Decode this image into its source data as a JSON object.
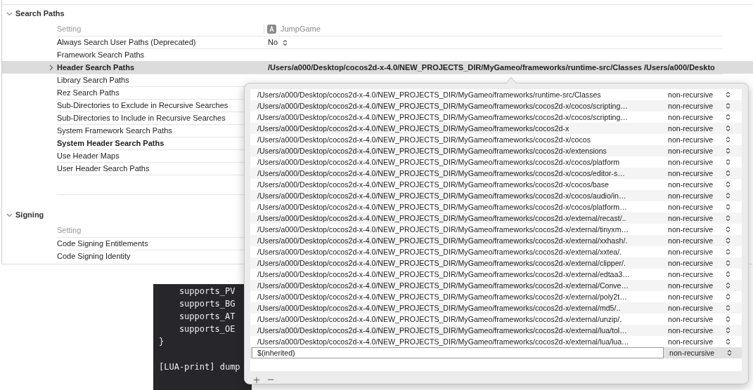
{
  "sections": [
    {
      "title": "Search Paths",
      "expanded": true,
      "column_header": "Setting",
      "target": "JumpGame",
      "rows": [
        {
          "name": "Always Search User Paths (Deprecated)",
          "kind": "popup",
          "value": "No",
          "customized": false,
          "selected": false
        },
        {
          "name": "Framework Search Paths",
          "kind": "plain",
          "customized": false,
          "selected": false
        },
        {
          "name": "Header Search Paths",
          "kind": "list",
          "value": "/Users/a000/Desktop/cocos2d-x-4.0/NEW_PROJECTS_DIR/MyGameo/frameworks/runtime-src/Classes /Users/a000/Deskto",
          "customized": true,
          "selected": true
        },
        {
          "name": "Library Search Paths",
          "kind": "plain",
          "customized": false,
          "selected": false
        },
        {
          "name": "Rez Search Paths",
          "kind": "plain",
          "customized": false,
          "selected": false
        },
        {
          "name": "Sub-Directories to Exclude in Recursive Searches",
          "kind": "plain",
          "customized": false,
          "selected": false
        },
        {
          "name": "Sub-Directories to Include in Recursive Searches",
          "kind": "plain",
          "customized": false,
          "selected": false
        },
        {
          "name": "System Framework Search Paths",
          "kind": "plain",
          "customized": false,
          "selected": false
        },
        {
          "name": "System Header Search Paths",
          "kind": "plain",
          "customized": true,
          "selected": false
        },
        {
          "name": "Use Header Maps",
          "kind": "plain",
          "customized": false,
          "selected": false
        },
        {
          "name": "User Header Search Paths",
          "kind": "plain",
          "customized": false,
          "selected": false
        }
      ]
    },
    {
      "title": "Signing",
      "expanded": true,
      "column_header": "Setting",
      "rows": [
        {
          "name": "Code Signing Entitlements",
          "kind": "plain",
          "customized": false,
          "selected": false
        },
        {
          "name": "Code Signing Identity",
          "kind": "plain",
          "customized": false,
          "selected": false
        }
      ]
    }
  ],
  "terminal": {
    "blocks": [
      {
        "lines": [
          "    supports_PV",
          "    supports_BG",
          "    supports_AT",
          "    supports_OE",
          "}"
        ]
      },
      {
        "lines": [
          "[LUA-print] dump"
        ]
      }
    ]
  },
  "popover": {
    "entries": [
      {
        "path": "/Users/a000/Desktop/cocos2d-x-4.0/NEW_PROJECTS_DIR/MyGameo/frameworks/runtime-src/Classes",
        "recursion": "non-recursive",
        "selected": false
      },
      {
        "path": "/Users/a000/Desktop/cocos2d-x-4.0/NEW_PROJECTS_DIR/MyGameo/frameworks/cocos2d-x/cocos/scripting…",
        "recursion": "non-recursive",
        "selected": false
      },
      {
        "path": "/Users/a000/Desktop/cocos2d-x-4.0/NEW_PROJECTS_DIR/MyGameo/frameworks/cocos2d-x/cocos/scripting…",
        "recursion": "non-recursive",
        "selected": false
      },
      {
        "path": "/Users/a000/Desktop/cocos2d-x-4.0/NEW_PROJECTS_DIR/MyGameo/frameworks/cocos2d-x",
        "recursion": "non-recursive",
        "selected": false
      },
      {
        "path": "/Users/a000/Desktop/cocos2d-x-4.0/NEW_PROJECTS_DIR/MyGameo/frameworks/cocos2d-x/cocos",
        "recursion": "non-recursive",
        "selected": false
      },
      {
        "path": "/Users/a000/Desktop/cocos2d-x-4.0/NEW_PROJECTS_DIR/MyGameo/frameworks/cocos2d-x/extensions",
        "recursion": "non-recursive",
        "selected": false
      },
      {
        "path": "/Users/a000/Desktop/cocos2d-x-4.0/NEW_PROJECTS_DIR/MyGameo/frameworks/cocos2d-x/cocos/platform",
        "recursion": "non-recursive",
        "selected": false
      },
      {
        "path": "/Users/a000/Desktop/cocos2d-x-4.0/NEW_PROJECTS_DIR/MyGameo/frameworks/cocos2d-x/cocos/editor-s…",
        "recursion": "non-recursive",
        "selected": false
      },
      {
        "path": "/Users/a000/Desktop/cocos2d-x-4.0/NEW_PROJECTS_DIR/MyGameo/frameworks/cocos2d-x/cocos/base",
        "recursion": "non-recursive",
        "selected": false
      },
      {
        "path": "/Users/a000/Desktop/cocos2d-x-4.0/NEW_PROJECTS_DIR/MyGameo/frameworks/cocos2d-x/cocos/audio/in…",
        "recursion": "non-recursive",
        "selected": false
      },
      {
        "path": "/Users/a000/Desktop/cocos2d-x-4.0/NEW_PROJECTS_DIR/MyGameo/frameworks/cocos2d-x/cocos/platform…",
        "recursion": "non-recursive",
        "selected": false
      },
      {
        "path": "/Users/a000/Desktop/cocos2d-x-4.0/NEW_PROJECTS_DIR/MyGameo/frameworks/cocos2d-x/external/recast/..",
        "recursion": "non-recursive",
        "selected": false
      },
      {
        "path": "/Users/a000/Desktop/cocos2d-x-4.0/NEW_PROJECTS_DIR/MyGameo/frameworks/cocos2d-x/external/tinyxm…",
        "recursion": "non-recursive",
        "selected": false
      },
      {
        "path": "/Users/a000/Desktop/cocos2d-x-4.0/NEW_PROJECTS_DIR/MyGameo/frameworks/cocos2d-x/external/xxhash/.",
        "recursion": "non-recursive",
        "selected": false
      },
      {
        "path": "/Users/a000/Desktop/cocos2d-x-4.0/NEW_PROJECTS_DIR/MyGameo/frameworks/cocos2d-x/external/xxtea/.",
        "recursion": "non-recursive",
        "selected": false
      },
      {
        "path": "/Users/a000/Desktop/cocos2d-x-4.0/NEW_PROJECTS_DIR/MyGameo/frameworks/cocos2d-x/external/clipper/.",
        "recursion": "non-recursive",
        "selected": false
      },
      {
        "path": "/Users/a000/Desktop/cocos2d-x-4.0/NEW_PROJECTS_DIR/MyGameo/frameworks/cocos2d-x/external/edtaa3…",
        "recursion": "non-recursive",
        "selected": false
      },
      {
        "path": "/Users/a000/Desktop/cocos2d-x-4.0/NEW_PROJECTS_DIR/MyGameo/frameworks/cocos2d-x/external/Conve…",
        "recursion": "non-recursive",
        "selected": false
      },
      {
        "path": "/Users/a000/Desktop/cocos2d-x-4.0/NEW_PROJECTS_DIR/MyGameo/frameworks/cocos2d-x/external/poly2t…",
        "recursion": "non-recursive",
        "selected": false
      },
      {
        "path": "/Users/a000/Desktop/cocos2d-x-4.0/NEW_PROJECTS_DIR/MyGameo/frameworks/cocos2d-x/external/md5/..",
        "recursion": "non-recursive",
        "selected": false
      },
      {
        "path": "/Users/a000/Desktop/cocos2d-x-4.0/NEW_PROJECTS_DIR/MyGameo/frameworks/cocos2d-x/external/unzip/.",
        "recursion": "non-recursive",
        "selected": false
      },
      {
        "path": "/Users/a000/Desktop/cocos2d-x-4.0/NEW_PROJECTS_DIR/MyGameo/frameworks/cocos2d-x/external/lua/tol…",
        "recursion": "non-recursive",
        "selected": false
      },
      {
        "path": "/Users/a000/Desktop/cocos2d-x-4.0/NEW_PROJECTS_DIR/MyGameo/frameworks/cocos2d-x/external/lua/lua…",
        "recursion": "non-recursive",
        "selected": false
      },
      {
        "path": "$(inherited)",
        "recursion": "non-recursive",
        "selected": true
      }
    ],
    "add_button": "+",
    "remove_button": "−"
  }
}
